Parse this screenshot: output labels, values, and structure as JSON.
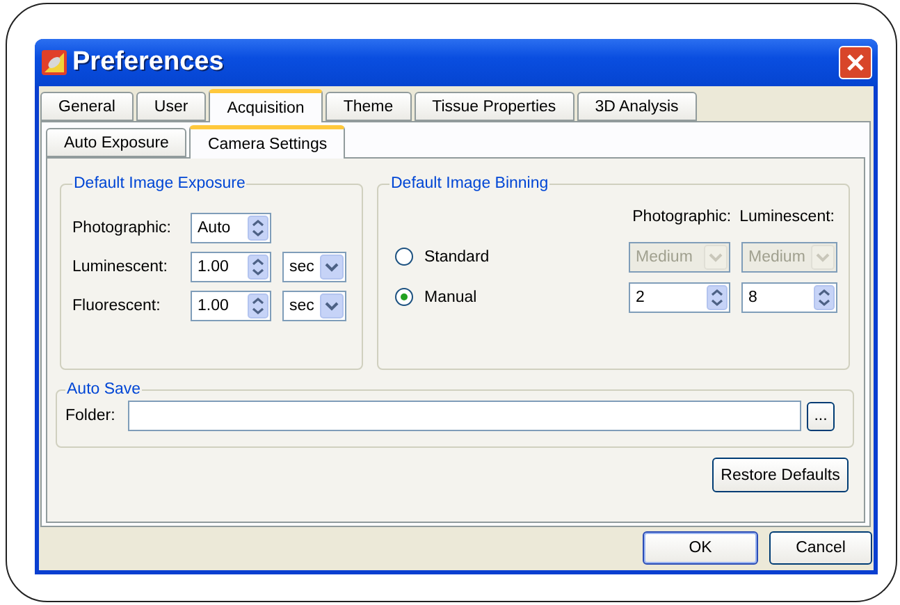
{
  "window": {
    "title": "Preferences"
  },
  "tabs": [
    {
      "label": "General",
      "selected": false
    },
    {
      "label": "User",
      "selected": false
    },
    {
      "label": "Acquisition",
      "selected": true
    },
    {
      "label": "Theme",
      "selected": false
    },
    {
      "label": "Tissue Properties",
      "selected": false
    },
    {
      "label": "3D Analysis",
      "selected": false
    }
  ],
  "subtabs": [
    {
      "label": "Auto Exposure",
      "selected": false
    },
    {
      "label": "Camera Settings",
      "selected": true
    }
  ],
  "exposure": {
    "title": "Default Image Exposure",
    "rows": [
      {
        "label": "Photographic:",
        "value": "Auto"
      },
      {
        "label": "Luminescent:",
        "value": "1.00",
        "unit": "sec"
      },
      {
        "label": "Fluorescent:",
        "value": "1.00",
        "unit": "sec"
      }
    ]
  },
  "binning": {
    "title": "Default Image Binning",
    "columns": [
      "Photographic:",
      "Luminescent:"
    ],
    "options": [
      {
        "label": "Standard",
        "selected": false,
        "kind": "combo",
        "values": [
          "Medium",
          "Medium"
        ],
        "disabled": true
      },
      {
        "label": "Manual",
        "selected": true,
        "kind": "spin",
        "values": [
          "2",
          "8"
        ],
        "disabled": false
      }
    ]
  },
  "auto_save": {
    "title": "Auto Save",
    "folder_label": "Folder:",
    "browse": "..."
  },
  "restore_button": "Restore Defaults",
  "buttons": [
    "OK",
    "Cancel"
  ]
}
